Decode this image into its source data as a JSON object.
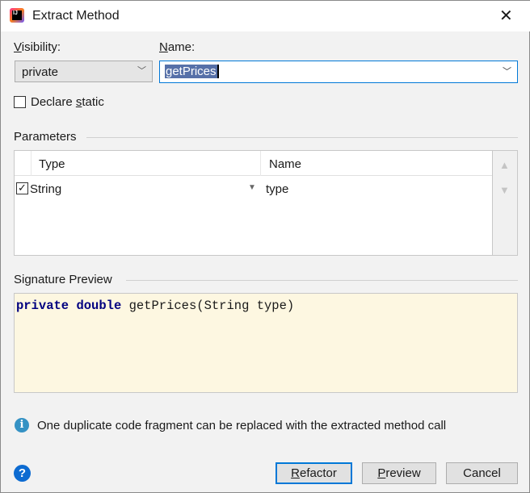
{
  "window": {
    "title": "Extract Method",
    "close_icon": "close-icon",
    "app_icon": "intellij-icon"
  },
  "visibility": {
    "label": "Visibility:",
    "value": "private"
  },
  "name": {
    "label": "Name:",
    "value": "getPrices"
  },
  "declare_static": {
    "label": "Declare static",
    "checked": false
  },
  "parameters": {
    "label": "Parameters",
    "columns": [
      "Type",
      "Name"
    ],
    "rows": [
      {
        "checked": true,
        "type": "String",
        "name": "type"
      }
    ]
  },
  "signature": {
    "label": "Signature Preview",
    "kw1": "private",
    "kw2": "double",
    "rest": "getPrices(String type)"
  },
  "info": {
    "text": "One duplicate code fragment can be replaced with the extracted method call"
  },
  "buttons": {
    "refactor": "Refactor",
    "preview": "Preview",
    "cancel": "Cancel"
  },
  "colors": {
    "accent": "#0078d7",
    "preview_bg": "#fdf7e1",
    "keyword": "#000080"
  }
}
